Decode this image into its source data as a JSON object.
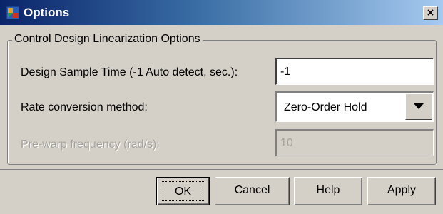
{
  "window": {
    "title": "Options",
    "icon": "matlab-app-icon",
    "close_label": "×"
  },
  "group": {
    "legend": "Control Design Linearization Options"
  },
  "rows": {
    "sample_time": {
      "label": "Design Sample Time (-1 Auto detect, sec.):",
      "value": "-1"
    },
    "rate_method": {
      "label": "Rate conversion method:",
      "selected": "Zero-Order Hold"
    },
    "prewarp": {
      "label": "Pre-warp frequency (rad/s):",
      "value": "10",
      "enabled": false
    }
  },
  "buttons": {
    "ok": "OK",
    "cancel": "Cancel",
    "help": "Help",
    "apply": "Apply"
  },
  "colors": {
    "face": "#d4d0c8",
    "title_start": "#0a246a",
    "title_end": "#a6caf0",
    "disabled_text": "#a5a29c"
  }
}
